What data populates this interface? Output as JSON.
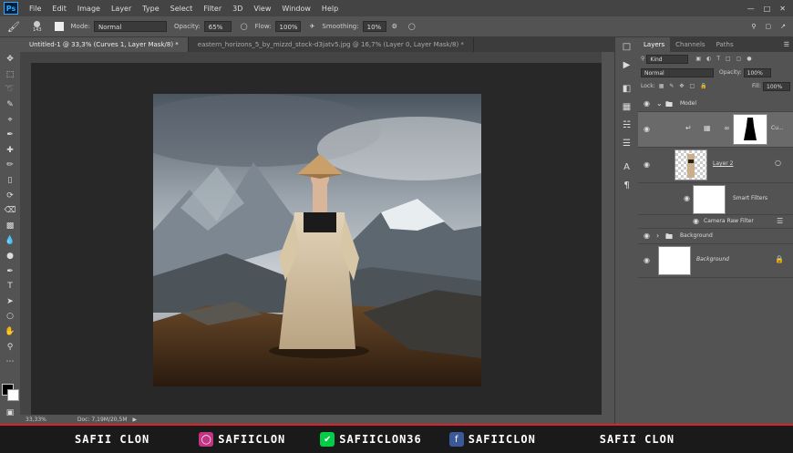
{
  "menu": {
    "logo": "Ps",
    "items": [
      "File",
      "Edit",
      "Image",
      "Layer",
      "Type",
      "Select",
      "Filter",
      "3D",
      "View",
      "Window",
      "Help"
    ]
  },
  "options": {
    "brush_size": "143",
    "mode_label": "Mode:",
    "mode_value": "Normal",
    "opacity_label": "Opacity:",
    "opacity_value": "65%",
    "flow_label": "Flow:",
    "flow_value": "100%",
    "smoothing_label": "Smoothing:",
    "smoothing_value": "10%"
  },
  "tabs": [
    {
      "label": "Untitled-1 @ 33,3% (Curves 1, Layer Mask/8) *"
    },
    {
      "label": "eastern_horizons_5_by_mizzd_stock-d3jatv5.jpg @ 16,7% (Layer 0, Layer Mask/8) *"
    }
  ],
  "status": {
    "zoom": "33,33%",
    "doc": "Doc: 7,19M/20,5M"
  },
  "layers_panel": {
    "tabs": [
      "Layers",
      "Channels",
      "Paths"
    ],
    "kind_label": "Kind",
    "blend_mode": "Normal",
    "opacity_label": "Opacity:",
    "opacity_value": "100%",
    "lock_label": "Lock:",
    "fill_label": "Fill:",
    "fill_value": "100%",
    "layers": [
      {
        "name": "Model"
      },
      {
        "name": "Cu..."
      },
      {
        "name": "Layer 2"
      },
      {
        "name": "Smart Filters"
      },
      {
        "name": "Camera Raw Filter"
      },
      {
        "name": "Background"
      },
      {
        "name": "Background"
      }
    ]
  },
  "banner": {
    "name": "SAFII CLON",
    "instagram": "SAFIICLON",
    "deviantart": "SAFIICLON36",
    "facebook": "SAFIICLON",
    "right": "SAFII CLON"
  },
  "colors": {
    "accent_red": "#e0202a",
    "instagram": "#c13584",
    "deviantart": "#05cc47",
    "facebook": "#3b5998"
  }
}
